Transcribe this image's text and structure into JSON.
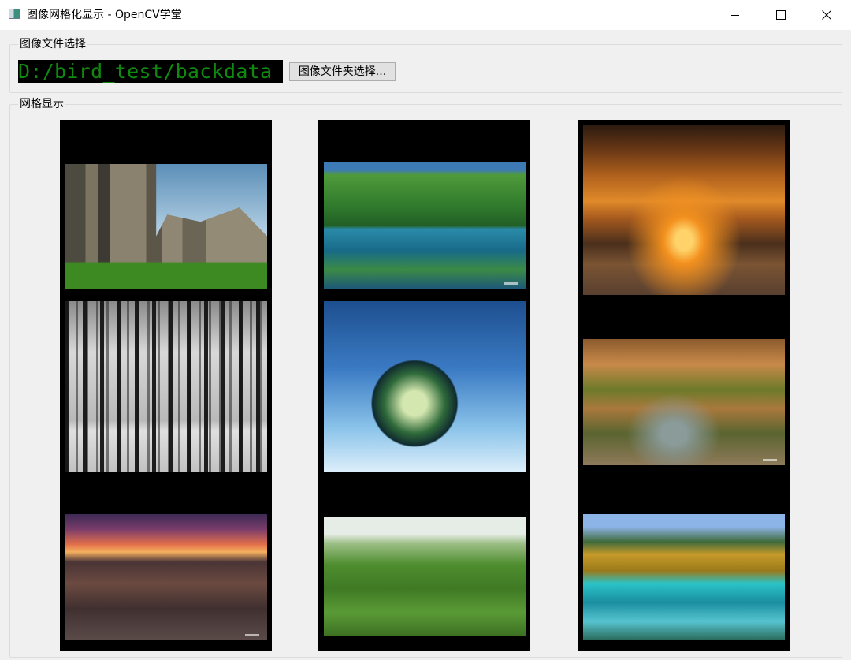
{
  "window": {
    "title": "图像网格化显示 - OpenCV学堂",
    "controls": [
      "minimize",
      "maximize",
      "close"
    ]
  },
  "file_group": {
    "label": "图像文件选择",
    "path_value": "D:/bird_test/backdata",
    "choose_button_label": "图像文件夹选择..."
  },
  "grid_group": {
    "label": "网格显示",
    "columns": [
      {
        "images": [
          "ruins-photo",
          "forest-bw-photo",
          "badlands-sunset-photo"
        ]
      },
      {
        "images": [
          "lake-reflection-photo",
          "planet-storm-art",
          "green-bushes-photo"
        ]
      },
      {
        "images": [
          "cloud-sunset-photo",
          "cave-rocks-photo",
          "autumn-lake-photo"
        ]
      }
    ]
  },
  "colors": {
    "path_background": "#000000",
    "path_text": "#0f8a0f",
    "grid_column_background": "#000000",
    "window_background": "#f0f0f0"
  }
}
